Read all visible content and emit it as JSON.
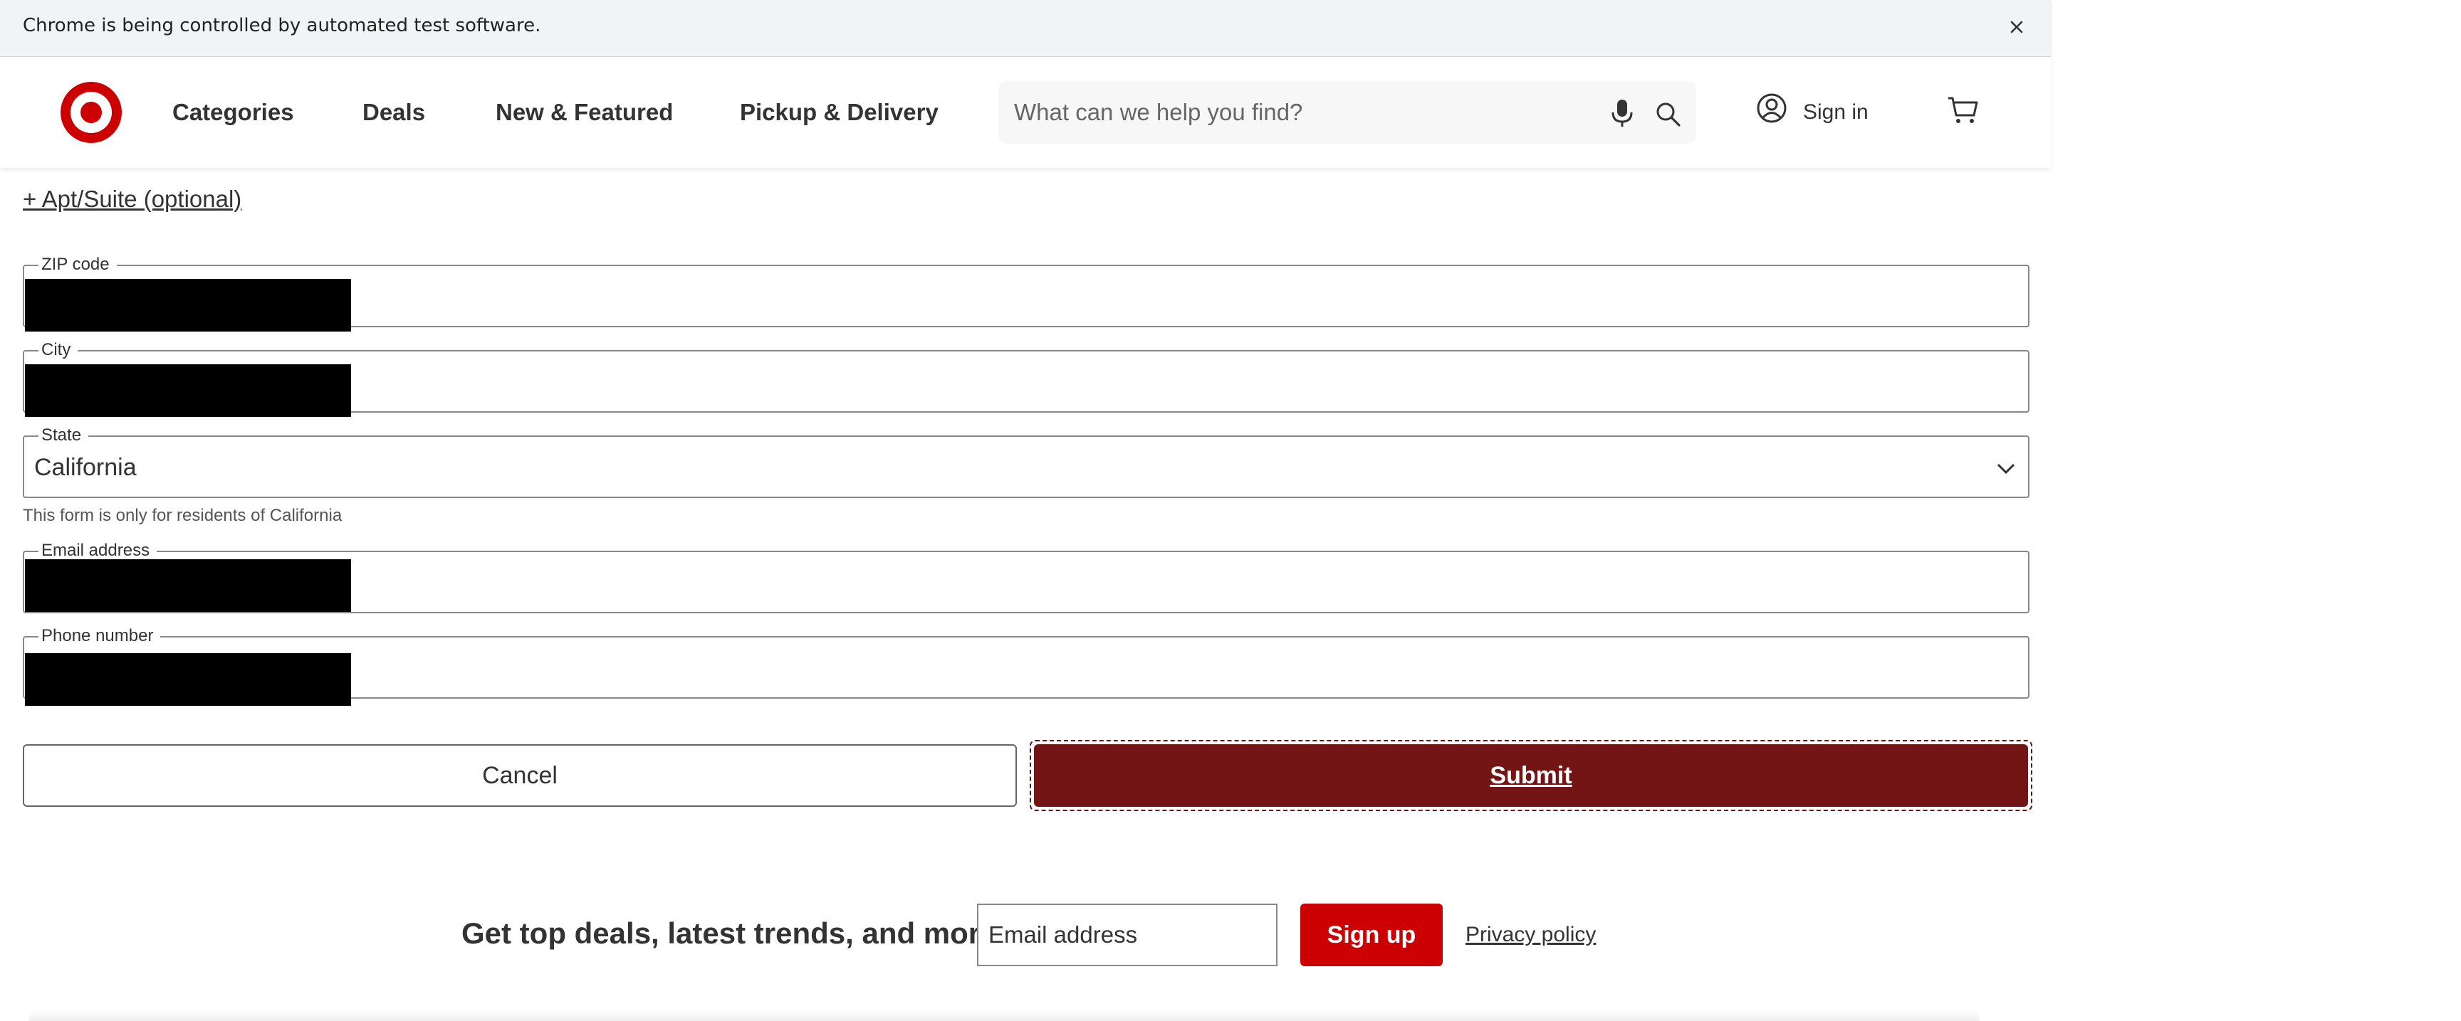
{
  "infobar": {
    "message": "Chrome is being controlled by automated test software.",
    "close_icon": "close-icon"
  },
  "header": {
    "logo_icon": "target-bullseye-logo",
    "brand_color": "#cc0000",
    "nav": [
      {
        "label": "Categories"
      },
      {
        "label": "Deals"
      },
      {
        "label": "New & Featured"
      },
      {
        "label": "Pickup & Delivery"
      }
    ],
    "search": {
      "placeholder": "What can we help you find?",
      "value": ""
    },
    "sign_in_label": "Sign in",
    "icons": [
      "microphone-icon",
      "search-icon",
      "user-account-icon",
      "cart-icon"
    ]
  },
  "form": {
    "apt_link": "+ Apt/Suite (optional)",
    "zip": {
      "label": "ZIP code",
      "value_redacted": true
    },
    "city": {
      "label": "City",
      "value_redacted": true
    },
    "state": {
      "label": "State",
      "value": "California"
    },
    "state_note": "This form is only for residents of California",
    "email": {
      "label": "Email address",
      "value_redacted": true
    },
    "phone": {
      "label": "Phone number",
      "value_redacted": true
    },
    "cancel_label": "Cancel",
    "submit_label": "Submit",
    "submit_color": "#721514"
  },
  "newsletter": {
    "headline": "Get top deals, latest trends, and more.",
    "email_placeholder": "Email address",
    "signup_label": "Sign up",
    "signup_color": "#cc0000",
    "privacy_label": "Privacy policy"
  }
}
